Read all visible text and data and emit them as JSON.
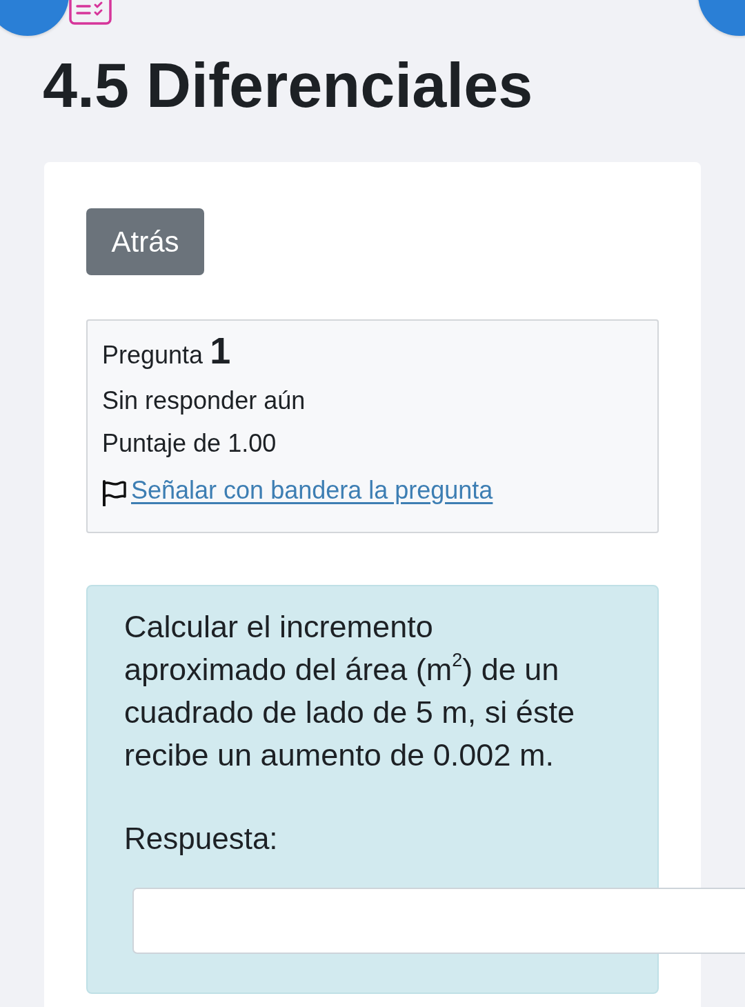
{
  "header": {
    "title": "4.5 Diferenciales"
  },
  "back_button": {
    "label": "Atrás"
  },
  "question_info": {
    "label": "Pregunta",
    "number": "1",
    "status": "Sin responder aún",
    "score": "Puntaje de 1.00",
    "flag_link": "Señalar con bandera la pregunta",
    "flagged": false
  },
  "question": {
    "text": "Calcular el incremento aproximado del área (m$^{2}$) de un cuadrado de lado de 5 m, si éste recibe un aumento de 0.002 m.",
    "answer_label": "Respuesta:"
  }
}
